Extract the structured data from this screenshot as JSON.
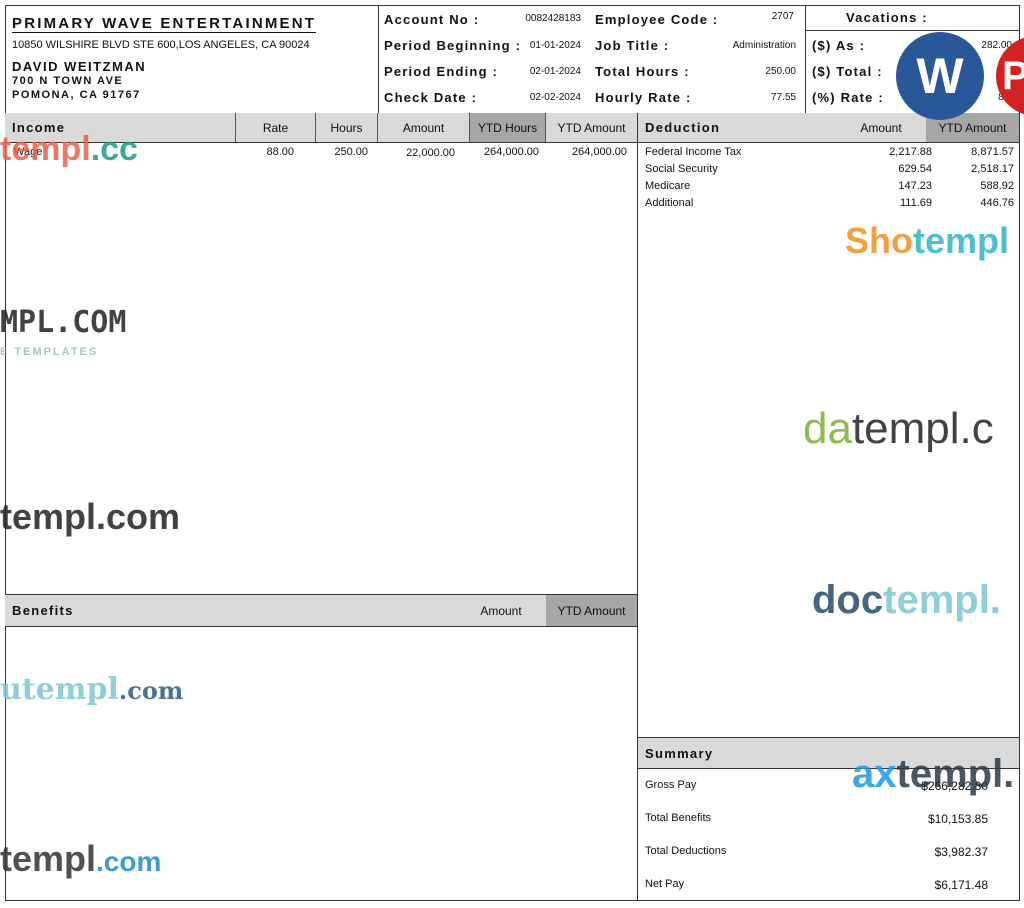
{
  "company": {
    "name": "PRIMARY WAVE ENTERTAINMENT",
    "address": "10850 WILSHIRE BLVD STE 600,LOS ANGELES, CA 90024"
  },
  "employee": {
    "name": "DAVID WEITZMAN",
    "street": "700 N TOWN AVE",
    "city": "POMONA, CA 91767"
  },
  "info": [
    {
      "label": "Account No :",
      "value": "0082428183"
    },
    {
      "label": "Period Beginning :",
      "value": "01-01-2024"
    },
    {
      "label": "Period Ending :",
      "value": "02-01-2024"
    },
    {
      "label": "Check Date :",
      "value": "02-02-2024"
    }
  ],
  "info2": [
    {
      "label": "Employee Code :",
      "value": "2707"
    },
    {
      "label": "Job Title :",
      "value": "Administration"
    },
    {
      "label": "Total Hours :",
      "value": "250.00"
    },
    {
      "label": "Hourly Rate :",
      "value": "77.55"
    }
  ],
  "vacations": {
    "title": "Vacations :",
    "rows": [
      {
        "label": "($) As  :",
        "value": "282.00"
      },
      {
        "label": "($) Total :",
        "value": "2"
      },
      {
        "label": "(%) Rate :",
        "value": "82."
      }
    ]
  },
  "income": {
    "headers": [
      "Income",
      "Rate",
      "Hours",
      "Amount",
      "YTD Hours",
      "YTD Amount"
    ],
    "rows": [
      {
        "label": "Wage",
        "rate": "88.00",
        "hours": "250.00",
        "amount": "22,000.00",
        "ytd_hours": "264,000.00",
        "ytd_amount": "264,000.00"
      }
    ]
  },
  "deduction": {
    "headers": [
      "Deduction",
      "Amount",
      "YTD Amount"
    ],
    "rows": [
      {
        "label": "Federal Income Tax",
        "amount": "2,217.88",
        "ytd": "8,871.57"
      },
      {
        "label": "Social Security",
        "amount": "629.54",
        "ytd": "2,518.17"
      },
      {
        "label": "Medicare",
        "amount": "147.23",
        "ytd": "588.92"
      },
      {
        "label": "Additional",
        "amount": "111.69",
        "ytd": "446.76"
      }
    ]
  },
  "benefits": {
    "headers": [
      "Benefits",
      "Amount",
      "YTD Amount"
    ]
  },
  "summary": {
    "title": "Summary",
    "rows": [
      {
        "label": "Gross Pay",
        "value": "$266,282.80"
      },
      {
        "label": "Total Benefits",
        "value": "$10,153.85"
      },
      {
        "label": "Total Deductions",
        "value": "$3,982.37"
      },
      {
        "label": "Net Pay",
        "value": "$6,171.48"
      }
    ]
  },
  "watermarks": [
    "templ.cc",
    "MPL.COM",
    "E TEMPLATES",
    "templ.com",
    "utempl.com",
    "templ.com",
    "Shotempl",
    "datempl.c",
    "doctempl.",
    "axtempl.",
    "W",
    "P"
  ]
}
